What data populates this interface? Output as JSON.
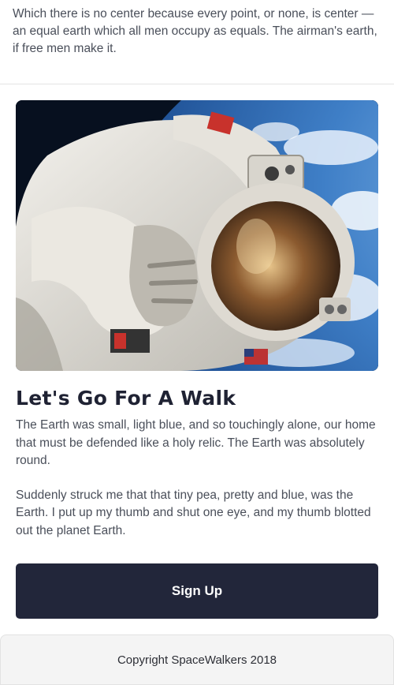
{
  "intro": {
    "text": "Which there is no center because every point, or none, is center — an equal earth which all men occupy as equals. The airman's earth, if free men make it."
  },
  "card": {
    "image_subject": "astronaut-spacewalk-photo",
    "title": "Let's Go For A Walk",
    "paragraphs": [
      "The Earth was small, light blue, and so touchingly alone, our home that must be defended like a holy relic. The Earth was absolutely round.",
      "Suddenly struck me that that tiny pea, pretty and blue, was the Earth. I put up my thumb and shut one eye, and my thumb blotted out the planet Earth."
    ]
  },
  "signup": {
    "label": "Sign Up"
  },
  "footer": {
    "copyright": "Copyright SpaceWalkers 2018"
  },
  "colors": {
    "button_bg": "#22263a",
    "title": "#1f2233",
    "body_text": "#4a4f5a",
    "footer_bg": "#f4f4f4"
  }
}
